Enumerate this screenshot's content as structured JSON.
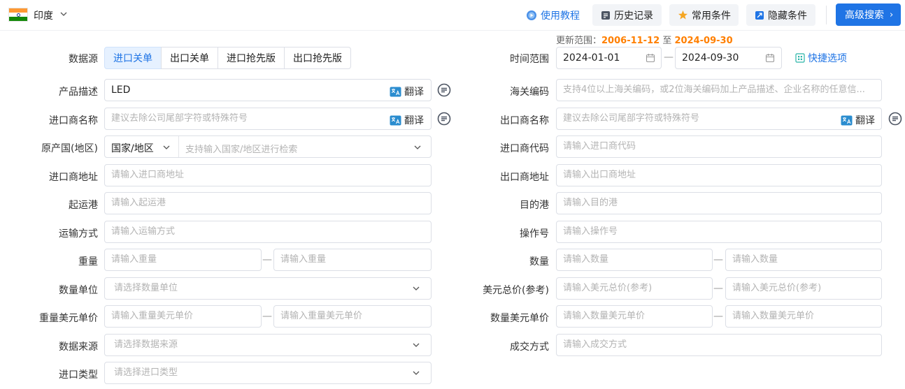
{
  "header": {
    "country": "印度",
    "tutorial": "使用教程",
    "history": "历史记录",
    "favorites": "常用条件",
    "hide_conditions": "隐藏条件",
    "advanced_search": "高级搜索",
    "flag_colors": [
      "#ff9933",
      "#ffffff",
      "#138808"
    ]
  },
  "update_range": {
    "prefix": "更新范围：",
    "start": "2006-11-12",
    "sep": "至",
    "end": "2024-09-30"
  },
  "data_source": {
    "label": "数据源",
    "tabs": [
      "进口关单",
      "出口关单",
      "进口抢先版",
      "出口抢先版"
    ],
    "active": 0
  },
  "time_range": {
    "label": "时间范围",
    "start": "2024-01-01",
    "end": "2024-09-30",
    "dash": "—",
    "quick_options": "快捷选项"
  },
  "translate_label": "翻译",
  "range_dash": "—",
  "left": {
    "product_desc": {
      "label": "产品描述",
      "value": "LED"
    },
    "importer_name": {
      "label": "进口商名称",
      "placeholder": "建议去除公司尾部字符或特殊符号"
    },
    "origin_country": {
      "label": "原产国(地区)",
      "selector": "国家/地区",
      "placeholder": "支持输入国家/地区进行检索"
    },
    "importer_address": {
      "label": "进口商地址",
      "placeholder": "请输入进口商地址"
    },
    "origin_port": {
      "label": "起运港",
      "placeholder": "请输入起运港"
    },
    "transport": {
      "label": "运输方式",
      "placeholder": "请输入运输方式"
    },
    "weight": {
      "label": "重量",
      "placeholder_from": "请输入重量",
      "placeholder_to": "请输入重量"
    },
    "quantity_unit": {
      "label": "数量单位",
      "placeholder": "请选择数量单位"
    },
    "weight_usd_price": {
      "label": "重量美元单价",
      "placeholder_from": "请输入重量美元单价",
      "placeholder_to": "请输入重量美元单价"
    },
    "data_origin": {
      "label": "数据来源",
      "placeholder": "请选择数据来源"
    },
    "import_type": {
      "label": "进口类型",
      "placeholder": "请选择进口类型"
    }
  },
  "right": {
    "hs_code": {
      "label": "海关编码",
      "placeholder": "支持4位以上海关编码，或2位海关编码加上产品描述、企业名称的任意信..."
    },
    "exporter_name": {
      "label": "出口商名称",
      "placeholder": "建议去除公司尾部字符或特殊符号"
    },
    "importer_code": {
      "label": "进口商代码",
      "placeholder": "请输入进口商代码"
    },
    "exporter_address": {
      "label": "出口商地址",
      "placeholder": "请输入出口商地址"
    },
    "dest_port": {
      "label": "目的港",
      "placeholder": "请输入目的港"
    },
    "operation_no": {
      "label": "操作号",
      "placeholder": "请输入操作号"
    },
    "quantity": {
      "label": "数量",
      "placeholder_from": "请输入数量",
      "placeholder_to": "请输入数量"
    },
    "total_usd": {
      "label": "美元总价(参考)",
      "placeholder_from": "请输入美元总价(参考)",
      "placeholder_to": "请输入美元总价(参考)"
    },
    "qty_usd_price": {
      "label": "数量美元单价",
      "placeholder_from": "请输入数量美元单价",
      "placeholder_to": "请输入数量美元单价"
    },
    "deal_method": {
      "label": "成交方式",
      "placeholder": "请输入成交方式"
    }
  },
  "icons": {
    "tutorial": "play-circle-icon",
    "history": "history-icon",
    "favorites": "star-icon",
    "hide": "hide-icon",
    "translate": "translate-icon",
    "side_search": "search-detail-icon",
    "calendar": "calendar-icon",
    "quick": "quick-options-icon"
  },
  "colors": {
    "primary": "#1f74e5",
    "date_highlight": "#ff7f00",
    "tab_active_bg": "#e6f1ff"
  }
}
